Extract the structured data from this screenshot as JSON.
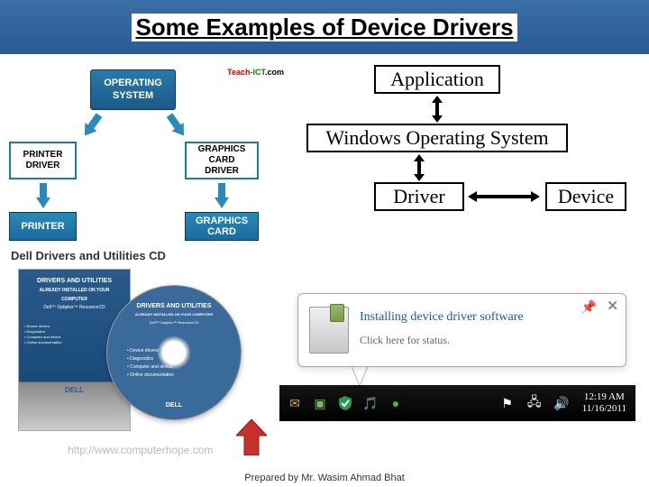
{
  "title": "Some Examples of Device Drivers",
  "left_diagram": {
    "logo_teach": "Teach",
    "logo_ict": "-ICT",
    "logo_com": ".com",
    "os": "OPERATING\nSYSTEM",
    "printer_driver": "PRINTER\nDRIVER",
    "gcard_driver": "GRAPHICS\nCARD\nDRIVER",
    "printer": "PRINTER",
    "gcard": "GRAPHICS\nCARD"
  },
  "right_diagram": {
    "application": "Application",
    "os": "Windows Operating System",
    "driver": "Driver",
    "device": "Device"
  },
  "dell": {
    "title": "Dell Drivers and Utilities CD",
    "drivers_utilities": "DRIVERS AND UTILITIES",
    "already_installed": "ALREADY INSTALLED ON YOUR COMPUTER",
    "optiplex": "Dell™ Optiplex™ ResourceCD",
    "bullets": "• Device drivers\n• Diagnostics\n• Computer and device\n• Online documentation",
    "dell_logo": "DELL"
  },
  "source_url": "http://www.computerhope.com",
  "notification": {
    "title": "Installing device driver software",
    "subtitle": "Click here for status."
  },
  "taskbar": {
    "time": "12:19 AM",
    "date": "11/16/2011"
  },
  "footer": "Prepared by Mr. Wasim Ahmad Bhat"
}
